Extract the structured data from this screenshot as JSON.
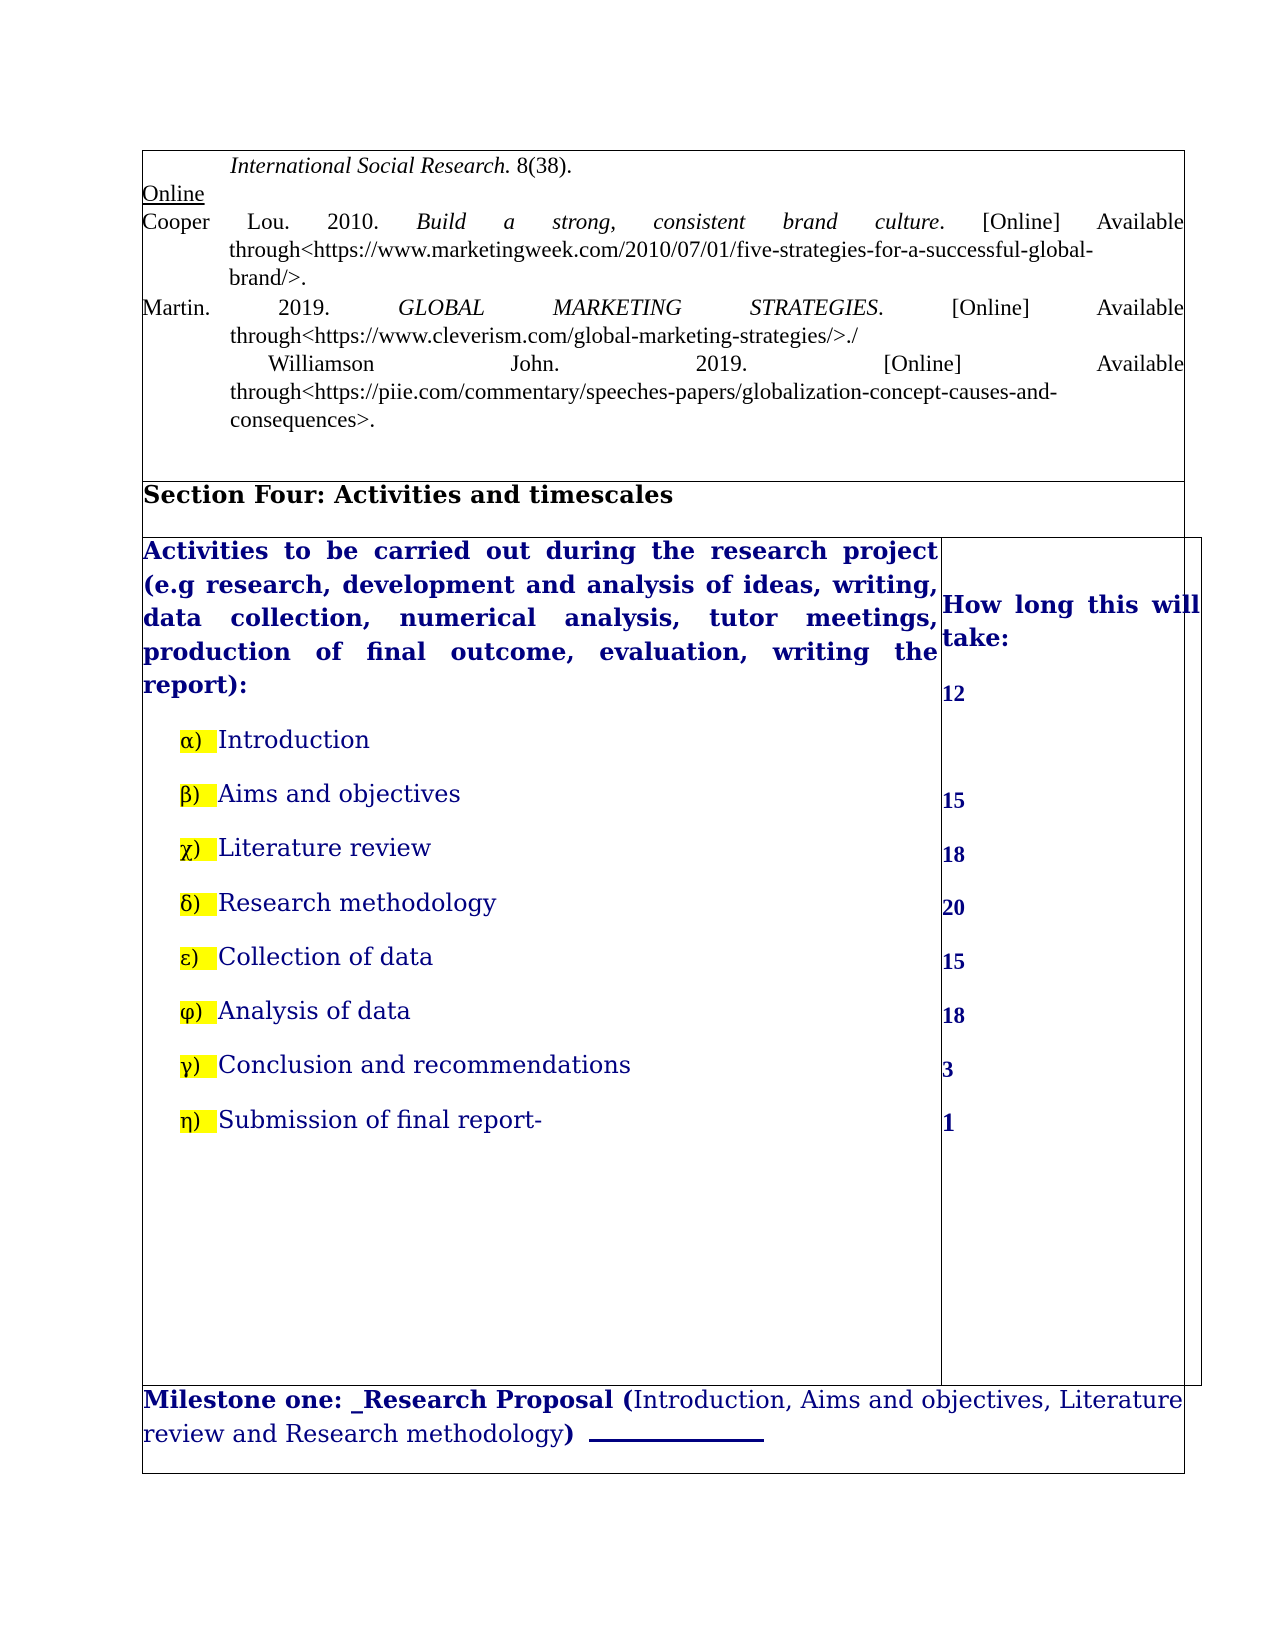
{
  "references": {
    "journal_tail_italic": "International Social Research.",
    "journal_tail_rest": " 8(38).",
    "online_heading": "Online",
    "entries": [
      {
        "author": "Cooper Lou.",
        "year": "2010.",
        "title": "Build a strong, consistent brand culture",
        "title_end": ".",
        "online": "[Online]",
        "available": "Available",
        "url_line1": "through<https://www.marketingweek.com/2010/07/01/five-strategies-for-a-successful-global-",
        "url_line2": "brand/>."
      },
      {
        "author": "Martin.",
        "year": "2019.",
        "title": "GLOBAL MARKETING STRATEGIES",
        "title_end": ".",
        "online": "[Online]",
        "available": "Available",
        "url_line1": "through<https://www.cleverism.com/global-marketing-strategies/>./"
      },
      {
        "author": "Williamson",
        "author2": "John.",
        "year": "2019.",
        "online": "[Online]",
        "available": "Available",
        "url_line1": "through<https://piie.com/commentary/speeches-papers/globalization-concept-causes-and-",
        "url_line2": "consequences>."
      }
    ]
  },
  "section": {
    "title": "Section Four: Activities and timescales"
  },
  "activities": {
    "header": "Activities to be carried out during the research project (e.g research, development and analysis of ideas, writing, data collection, numerical analysis, tutor meetings, production of final outcome, evaluation, writing the report):",
    "duration_header": "How long this will take:",
    "highlight_color": "#ffff00",
    "text_color": "#000080",
    "items": [
      {
        "marker": "α)",
        "label": "Introduction"
      },
      {
        "marker": "β)",
        "label": "Aims and objectives"
      },
      {
        "marker": "χ)",
        "label": "Literature review"
      },
      {
        "marker": "δ)",
        "label": "Research methodology"
      },
      {
        "marker": "ε)",
        "label": "Collection of data"
      },
      {
        "marker": "φ)",
        "label": "Analysis of data"
      },
      {
        "marker": "γ)",
        "label": "Conclusion and recommendations"
      },
      {
        "marker": "η)",
        "label": "Submission of final report-"
      }
    ],
    "durations": [
      "12",
      "15",
      "18",
      "20",
      "15",
      "18",
      "3",
      "1"
    ]
  },
  "milestone": {
    "label_bold": "Milestone one: _Research Proposal (",
    "description": "Introduction, Aims and objectives, Literature review and Research methodology",
    "close_bold": ")"
  }
}
